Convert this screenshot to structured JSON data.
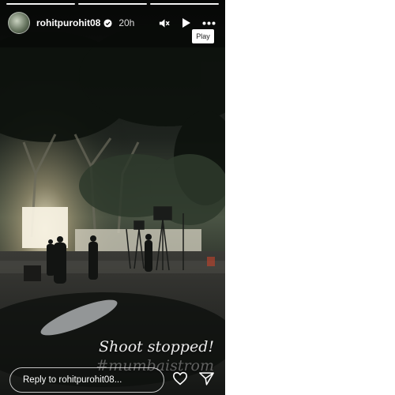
{
  "story": {
    "username": "rohitpurohit08",
    "time": "20h",
    "tooltip": "Play",
    "caption_line1": "Shoot stopped!",
    "caption_line2": "#mumbaistrom",
    "reply_placeholder": "Reply to rohitpurohit08...",
    "progress": [
      1,
      1,
      1
    ]
  },
  "icons": {
    "verified": "verified-badge-icon",
    "mute": "muted-speaker-icon",
    "play": "play-icon",
    "more": "more-dots-icon",
    "like": "heart-icon",
    "share": "send-icon"
  },
  "colors": {
    "verified": "#3897f0",
    "ui": "#ffffff"
  }
}
